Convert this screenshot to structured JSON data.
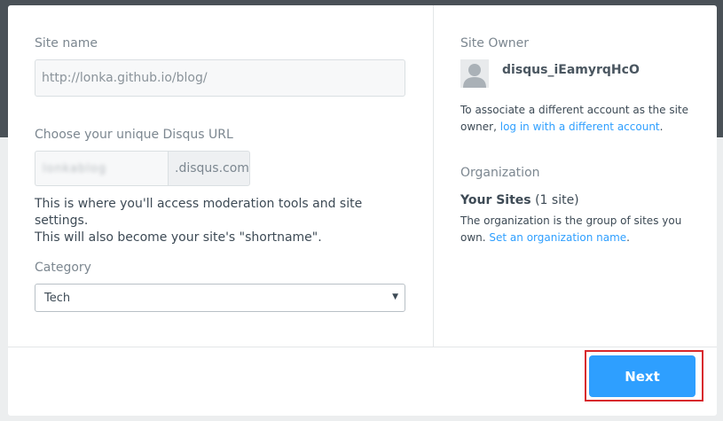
{
  "site_form": {
    "site_name_label": "Site name",
    "site_name_value": "http://lonka.github.io/blog/",
    "disqus_url_label": "Choose your unique Disqus URL",
    "disqus_url_value": "lonkablog",
    "disqus_url_suffix": ".disqus.com",
    "help_line1": "This is where you'll access moderation tools and site settings.",
    "help_line2": "This will also become your site's \"shortname\".",
    "category_label": "Category",
    "category_selected": "Tech"
  },
  "owner": {
    "section_title": "Site Owner",
    "username": "disqus_iEamyrqHcO",
    "assoc_text": "To associate a different account as the site owner,",
    "assoc_link": "log in with a different account",
    "assoc_end": "."
  },
  "organization": {
    "section_title": "Organization",
    "name": "Your Sites",
    "count": "(1 site)",
    "desc": "The organization is the group of sites you own.",
    "link": "Set an organization name",
    "link_end": "."
  },
  "footer": {
    "next_label": "Next"
  },
  "colors": {
    "accent": "#2e9fff",
    "highlight_outline": "#d8282d",
    "header_bg": "#4a5157"
  }
}
